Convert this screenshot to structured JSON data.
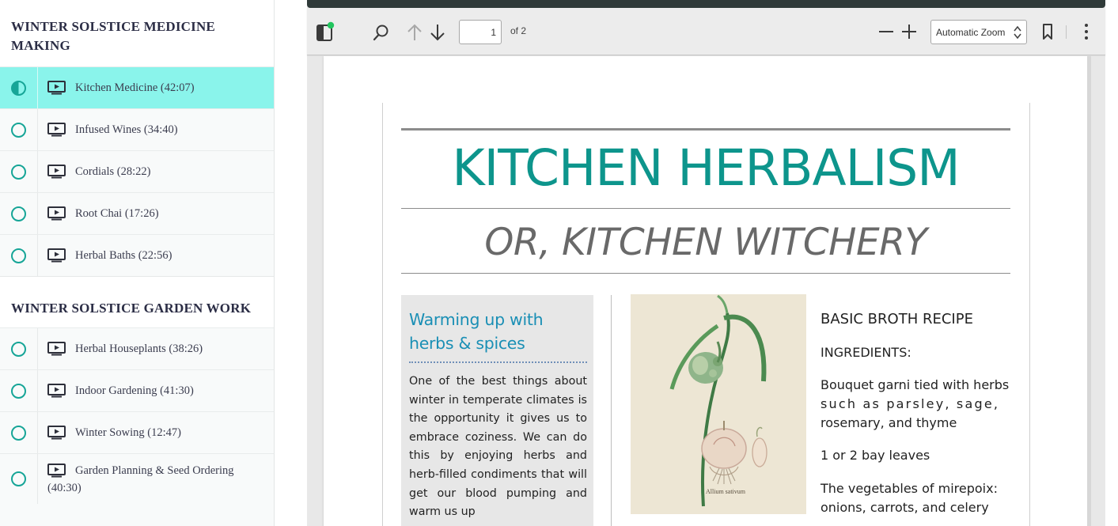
{
  "sidebar": {
    "sections": [
      {
        "title": "WINTER SOLSTICE MEDICINE MAKING",
        "lessons": [
          {
            "label": "Kitchen Medicine (42:07)",
            "status": "in-progress"
          },
          {
            "label": "Infused Wines (34:40)",
            "status": "not-started"
          },
          {
            "label": "Cordials (28:22)",
            "status": "not-started"
          },
          {
            "label": "Root Chai (17:26)",
            "status": "not-started"
          },
          {
            "label": "Herbal Baths (22:56)",
            "status": "not-started"
          }
        ]
      },
      {
        "title": "WINTER SOLSTICE GARDEN WORK",
        "lessons": [
          {
            "label": "Herbal Houseplants (38:26)",
            "status": "not-started"
          },
          {
            "label": "Indoor Gardening (41:30)",
            "status": "not-started"
          },
          {
            "label": "Winter Sowing (12:47)",
            "status": "not-started"
          },
          {
            "label_line1": "Garden Planning & Seed Ordering",
            "label_line2": "(40:30)",
            "status": "not-started"
          }
        ]
      }
    ]
  },
  "viewer": {
    "toolbar": {
      "page_number": "1",
      "page_total": "of 2",
      "zoom": "Automatic Zoom",
      "icons": [
        "sidebar-toggle-icon",
        "search-icon",
        "arrow-up-icon",
        "arrow-down-icon",
        "zoom-out-icon",
        "zoom-in-icon",
        "bookmark-icon",
        "more-vertical-icon"
      ]
    },
    "document": {
      "title": "KITCHEN HERBALISM",
      "subtitle": "OR, KITCHEN WITCHERY",
      "sidebox": {
        "title_line1": "Warming up with",
        "title_line2": "herbs & spices",
        "body": "One of the best things about winter in temperate climates is the opportunity it gives us to embrace coziness. We can do this by enjoying herbs and herb-filled condiments that will get our blood pumping and warm us up"
      },
      "plate_caption": "Allium sativum",
      "recipe": {
        "title": "BASIC BROTH RECIPE",
        "ingredients_label": "INGREDIENTS:",
        "item1_a": "Bouquet garni tied with herbs",
        "item1_b": "such as parsley, sage,",
        "item1_c": "rosemary, and thyme",
        "item2": "1 or 2 bay leaves",
        "item3_a": "The vegetables of mirepoix:",
        "item3_b": "onions, carrots, and celery"
      }
    }
  },
  "colors": {
    "accent": "#16a597",
    "active_row": "#8af4eb",
    "title_teal": "#0d958c",
    "subtitle_gray": "#696969",
    "box_title_blue": "#1a8fb5",
    "notification_dot": "#22c55e"
  }
}
